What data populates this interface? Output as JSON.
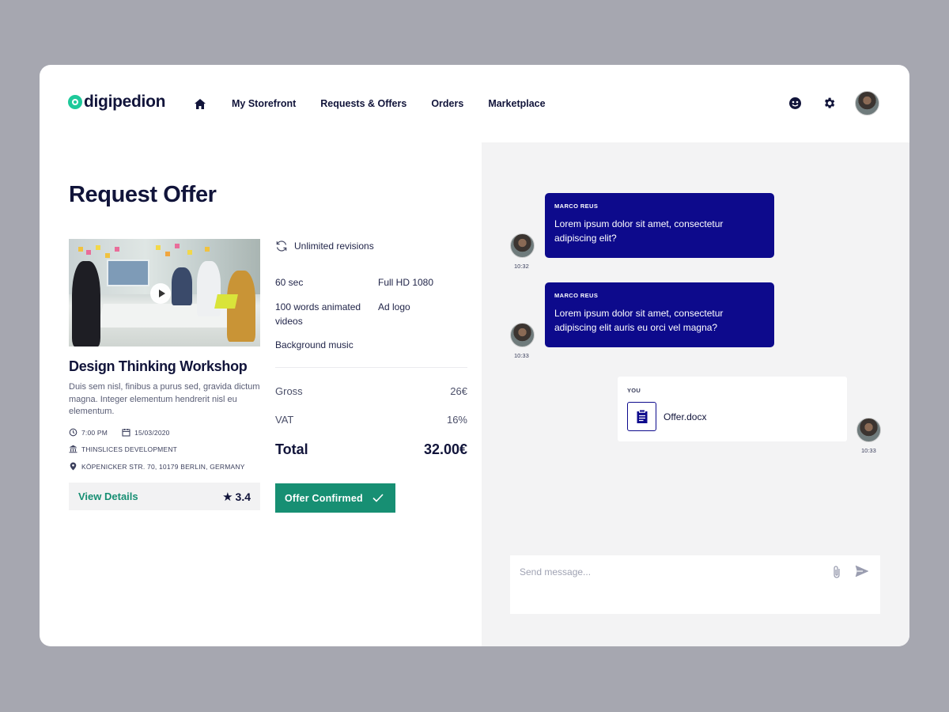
{
  "brand": {
    "name": "digipedion",
    "accent": "#1ec99a"
  },
  "nav": {
    "home_icon": "home-icon",
    "items": [
      "My Storefront",
      "Requests & Offers",
      "Orders",
      "Marketplace"
    ]
  },
  "header_icons": [
    "smiley-icon",
    "gear-icon",
    "user-avatar"
  ],
  "page": {
    "title": "Request Offer"
  },
  "workshop": {
    "title": "Design Thinking Workshop",
    "description": "Duis sem nisl, finibus a purus sed, gravida dictum magna. Integer elementum hendrerit nisl eu elementum.",
    "time": "7:00 PM",
    "date": "15/03/2020",
    "company": "THINSLICES DEVELOPMENT",
    "address": "KÖPENICKER STR. 70, 10179 BERLIN, GERMANY",
    "view_details_label": "View Details",
    "rating": "3.4"
  },
  "offer": {
    "revisions": "Unlimited revisions",
    "features": [
      "60 sec",
      "Full HD 1080",
      "100 words animated videos",
      "Ad logo",
      "Background music"
    ],
    "gross_label": "Gross",
    "gross_value": "26€",
    "vat_label": "VAT",
    "vat_value": "16%",
    "total_label": "Total",
    "total_value": "32.00€",
    "confirm_label": "Offer Confirmed"
  },
  "chat": {
    "messages": [
      {
        "sender": "MARCO REUS",
        "text": "Lorem ipsum dolor sit amet, consectetur adipiscing elit?",
        "time": "10:32"
      },
      {
        "sender": "MARCO REUS",
        "text": "Lorem ipsum dolor sit amet, consectetur adipiscing elit auris eu orci vel magna?",
        "time": "10:33"
      }
    ],
    "own": {
      "label": "YOU",
      "file_name": "Offer.docx",
      "time": "10:33"
    },
    "input_placeholder": "Send message..."
  },
  "colors": {
    "primary_dark": "#11143a",
    "chat_bubble": "#0d0a8c",
    "confirm_green": "#178f73",
    "backdrop": "#a6a7b0",
    "chat_panel": "#f3f3f4"
  }
}
